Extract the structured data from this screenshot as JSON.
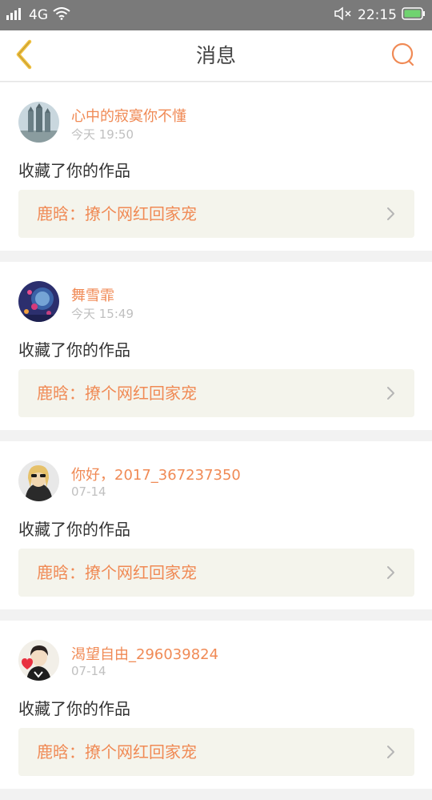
{
  "status_bar": {
    "network": "4G",
    "time": "22:15"
  },
  "navbar": {
    "title": "消息",
    "back_icon": "chevron-left-icon",
    "search_icon": "search-icon"
  },
  "colors": {
    "accent": "#f08a55",
    "back_icon": "#f0c040",
    "status_bar": "#7a7a7a",
    "work_bg": "#f4f4ec"
  },
  "messages": [
    {
      "username": "心中的寂寞你不懂",
      "time": "今天 19:50",
      "action": "收藏了你的作品",
      "work_title": "鹿晗：撩个网红回家宠"
    },
    {
      "username": "舞雪霏",
      "time": "今天 15:49",
      "action": "收藏了你的作品",
      "work_title": "鹿晗：撩个网红回家宠"
    },
    {
      "username": "你好，2017_367237350",
      "time": "07-14",
      "action": "收藏了你的作品",
      "work_title": "鹿晗：撩个网红回家宠"
    },
    {
      "username": "渴望自由_296039824",
      "time": "07-14",
      "action": "收藏了你的作品",
      "work_title": "鹿晗：撩个网红回家宠"
    }
  ]
}
